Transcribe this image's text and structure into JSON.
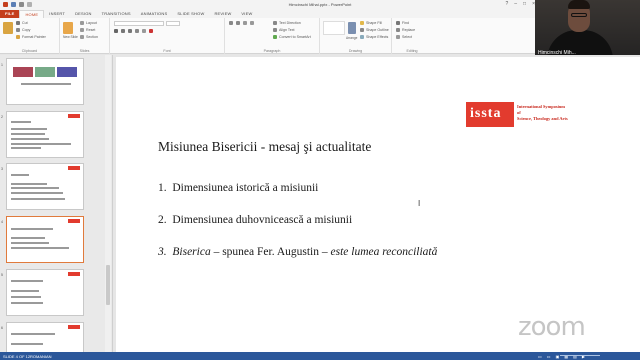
{
  "window": {
    "title": "Himcinschi Mihai.pptx - PowerPoint"
  },
  "ribbon": {
    "tabs": [
      "FILE",
      "HOME",
      "INSERT",
      "DESIGN",
      "TRANSITIONS",
      "ANIMATIONS",
      "SLIDE SHOW",
      "REVIEW",
      "VIEW"
    ],
    "clipboard": {
      "cut": "Cut",
      "copy": "Copy",
      "format_painter": "Format Painter",
      "label": "Clipboard"
    },
    "slides": {
      "new_slide": "New Slide",
      "layout": "Layout",
      "reset": "Reset",
      "section": "Section",
      "label": "Slides"
    },
    "font": {
      "label": "Font"
    },
    "paragraph": {
      "text_direction": "Text Direction",
      "align_text": "Align Text",
      "smartart": "Convert to SmartArt",
      "label": "Paragraph"
    },
    "drawing": {
      "arrange": "Arrange",
      "quick_styles": "Quick Styles",
      "shape_fill": "Shape Fill",
      "shape_outline": "Shape Outline",
      "shape_effects": "Shape Effects",
      "label": "Drawing"
    },
    "editing": {
      "find": "Find",
      "replace": "Replace",
      "select": "Select",
      "label": "Editing"
    }
  },
  "webcam": {
    "participant_name": "Himcinschi Mih..."
  },
  "slide": {
    "title": "Misiunea Bisericii - mesaj şi actualitate",
    "items": [
      {
        "num": "1.",
        "text": "Dimensiunea istorică a misiunii"
      },
      {
        "num": "2.",
        "text": "Dimensiunea duhovnicească a misiunii"
      }
    ],
    "item3": {
      "num": "3.",
      "part1": "Biserica",
      "part2": " – spunea Fer. Augustin – ",
      "part3": "este lumea reconciliată"
    },
    "logo": {
      "mark": "issta",
      "line1": "International Symposium",
      "line2": "of",
      "line3": "Science, Theology and Arts"
    }
  },
  "watermark": {
    "text": "zoom"
  },
  "statusbar": {
    "slide": "SLIDE 4 OF 12",
    "language": "ROMANIAN",
    "zoom": ""
  },
  "colors": {
    "accent": "#c43e1c",
    "logo_red": "#e23b2e",
    "statusbar": "#2b579a"
  }
}
